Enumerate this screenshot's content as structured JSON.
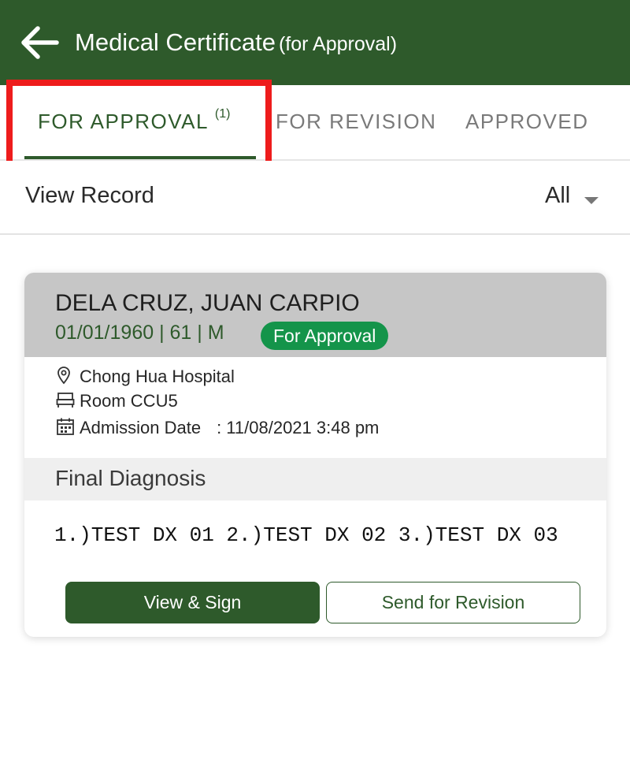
{
  "header": {
    "title": "Medical Certificate",
    "subtitle": "(for Approval)",
    "back_icon": "arrow-left-icon",
    "color": "#2e5a2b"
  },
  "tabs": [
    {
      "label": "FOR APPROVAL",
      "count": "(1)",
      "active": true
    },
    {
      "label": "FOR REVISION",
      "active": false
    },
    {
      "label": "APPROVED",
      "active": false
    }
  ],
  "filter": {
    "label": "View Record",
    "selected": "All"
  },
  "card": {
    "patient_name": "DELA CRUZ, JUAN CARPIO",
    "patient_meta": "01/01/1960 | 61 | M",
    "status": "For Approval",
    "status_color": "#14944a",
    "hospital": "Chong Hua Hospital",
    "room": "Room CCU5",
    "admission_label": "Admission Date",
    "admission_value": ": 11/08/2021 3:48 pm",
    "diagnosis_title": "Final Diagnosis",
    "diagnosis_text": "1.)TEST DX 01 2.)TEST DX 02 3.)TEST DX 03",
    "primary_button": "View & Sign",
    "secondary_button": "Send for Revision"
  },
  "highlight_color": "#ee1c1c"
}
